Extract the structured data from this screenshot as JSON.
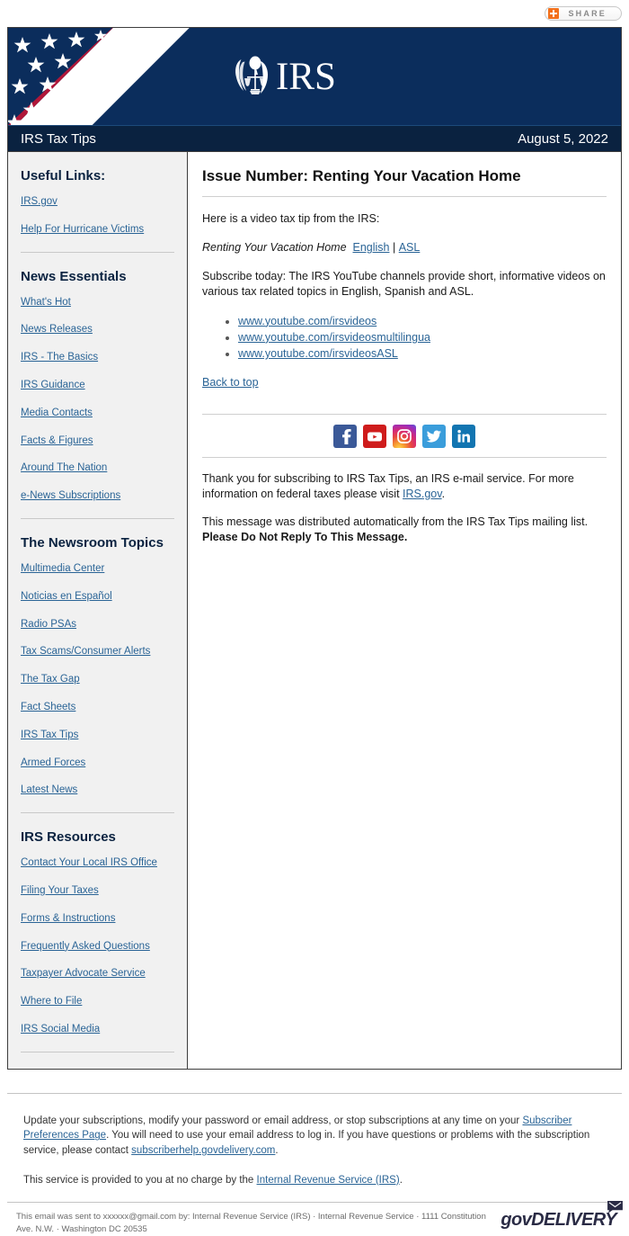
{
  "share": {
    "label": "SHARE",
    "icon": "plus-icon",
    "accent_color": "#f3701b"
  },
  "masthead": {
    "logo_text": "IRS",
    "logo_icon": "irs-eagle-scales-emblem",
    "flag_icon": "us-flag-diagonal-stripes",
    "background_color": "#0b2d5c"
  },
  "titlebar": {
    "publication": "IRS Tax Tips",
    "date": "August  5, 2022",
    "background_color": "#0a2240"
  },
  "sidebar": {
    "sections": [
      {
        "heading": "Useful Links:",
        "links": [
          "IRS.gov",
          "Help For Hurricane Victims"
        ]
      },
      {
        "heading": "News Essentials",
        "links": [
          "What's Hot",
          "News Releases",
          "IRS - The Basics",
          "IRS Guidance",
          "Media Contacts",
          "Facts & Figures",
          "Around The Nation",
          "e-News Subscriptions"
        ]
      },
      {
        "heading": "The Newsroom Topics",
        "links": [
          "Multimedia Center",
          "Noticias en Español",
          "Radio PSAs",
          "Tax Scams/Consumer Alerts",
          "The Tax Gap",
          "Fact Sheets",
          "IRS Tax Tips",
          "Armed Forces",
          "Latest News"
        ]
      },
      {
        "heading": "IRS Resources",
        "links": [
          "Contact Your Local IRS Office",
          "Filing Your Taxes",
          "Forms & Instructions",
          "Frequently Asked Questions",
          "Taxpayer Advocate Service",
          "Where to File",
          "IRS Social Media"
        ]
      }
    ]
  },
  "content": {
    "issue_title": "Issue Number:  Renting Your Vacation Home",
    "intro": "Here is a video tax tip from the IRS:",
    "video": {
      "title": "Renting Your Vacation Home",
      "link_english": "English",
      "separator": "|",
      "link_asl": "ASL"
    },
    "subscribe_text": "Subscribe today: The IRS YouTube channels provide short, informative videos on various tax related topics in English, Spanish and ASL.",
    "channel_links": [
      "www.youtube.com/irsvideos",
      "www.youtube.com/irsvideosmultilingua",
      "www.youtube.com/irsvideosASL"
    ],
    "back_to_top": "Back to top",
    "social_icons": [
      "facebook-icon",
      "youtube-icon",
      "instagram-icon",
      "twitter-icon",
      "linkedin-icon"
    ],
    "thanks_part1": "Thank you for subscribing to IRS Tax Tips, an IRS e-mail service. For more information on federal taxes please visit ",
    "thanks_link": "IRS.gov",
    "thanks_part2": ".",
    "distributed_part1": "This message was distributed automatically from the IRS Tax Tips mailing list. ",
    "distributed_bold": "Please Do Not Reply To This Message."
  },
  "footer": {
    "para1_a": "Update your subscriptions, modify your password or email address, or stop subscriptions at any time on your ",
    "para1_link1": "Subscriber Preferences Page",
    "para1_b": ". You will need to use your email address to log in. If you have questions or problems with the subscription service, please contact ",
    "para1_link2": "subscriberhelp.govdelivery.com",
    "para1_c": ".",
    "para2_a": "This service is provided to you at no charge by the ",
    "para2_link": "Internal Revenue Service (IRS)",
    "para2_b": ".",
    "sent_to": "This email was sent to xxxxxx@gmail.com by: Internal Revenue Service (IRS) · Internal Revenue Service · 1111 Constitution Ave. N.W. · Washington DC 20535",
    "govdelivery_word": "govDELIVERY",
    "govdelivery_icon": "envelope-icon"
  }
}
